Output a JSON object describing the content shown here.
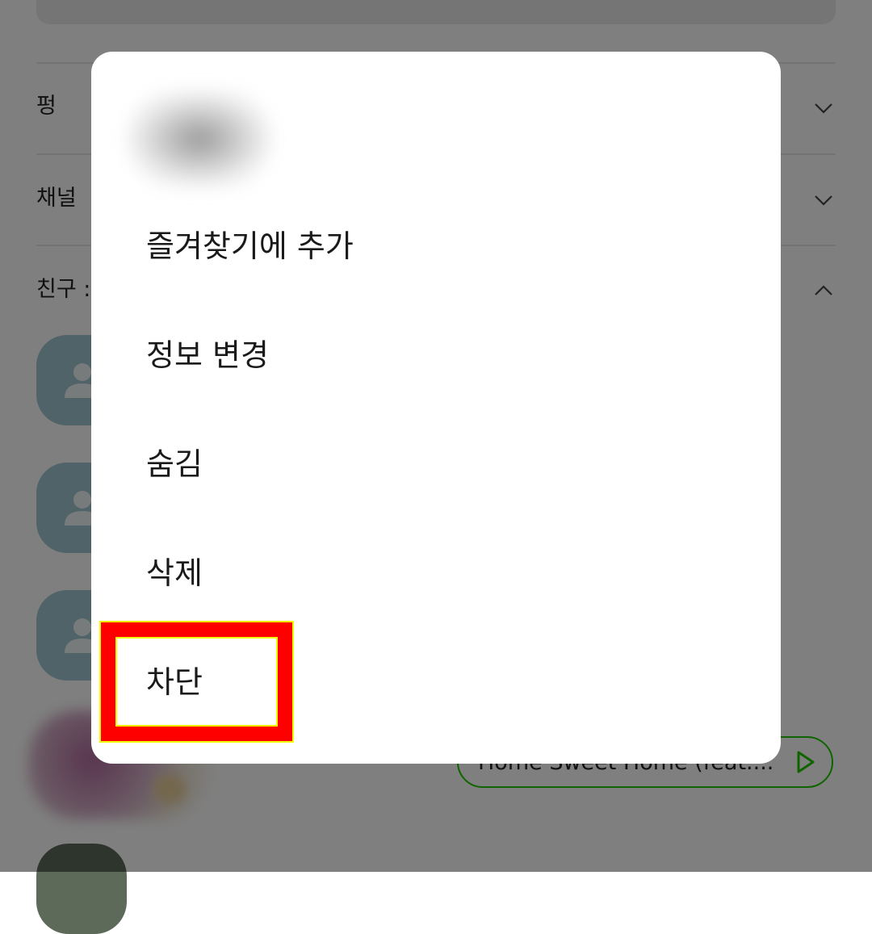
{
  "background": {
    "sections": [
      {
        "label": "펑"
      },
      {
        "label": "채널"
      },
      {
        "label": "친구 :"
      }
    ],
    "music_chip_text": "Home Sweet Home (feat...."
  },
  "menu": {
    "items": [
      {
        "label": "즐겨찾기에 추가"
      },
      {
        "label": "정보 변경"
      },
      {
        "label": "숨김"
      },
      {
        "label": "삭제"
      },
      {
        "label": "차단"
      }
    ]
  },
  "colors": {
    "accent_green": "#1ec800",
    "highlight_red": "#ff0000",
    "highlight_yellow": "#f2ff00",
    "avatar_bg": "#9ec7d1"
  },
  "icons": [
    "chevron-down-icon",
    "chevron-up-icon",
    "person-icon",
    "play-icon"
  ]
}
